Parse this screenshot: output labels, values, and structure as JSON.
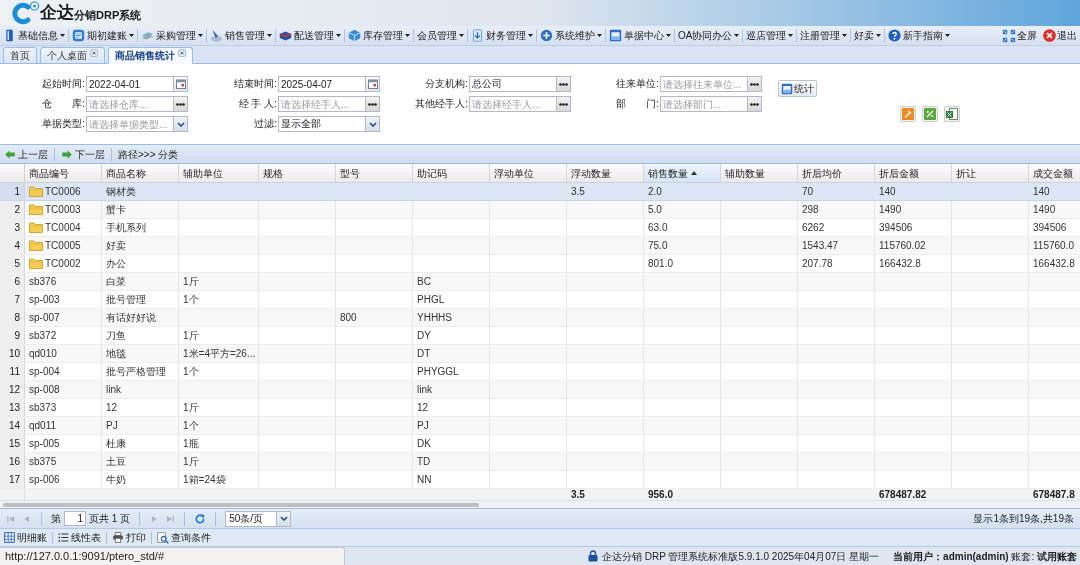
{
  "header": {
    "logo_main": "企达",
    "logo_sub": "分销DRP系统"
  },
  "menu": {
    "items": [
      {
        "label": "基础信息",
        "icon": true
      },
      {
        "label": "期初建账",
        "icon": true
      },
      {
        "label": "采购管理",
        "icon": true
      },
      {
        "label": "销售管理",
        "icon": true
      },
      {
        "label": "配送管理",
        "icon": true
      },
      {
        "label": "库存管理",
        "icon": true
      },
      {
        "label": "会员管理",
        "icon": false
      },
      {
        "label": "财务管理",
        "icon": true
      },
      {
        "label": "系统维护",
        "icon": true
      },
      {
        "label": "单据中心",
        "icon": true
      },
      {
        "label": "OA协同办公",
        "icon": false
      },
      {
        "label": "巡店管理",
        "icon": false
      },
      {
        "label": "注册管理",
        "icon": false
      },
      {
        "label": "好卖",
        "icon": false
      },
      {
        "label": "新手指南",
        "icon": true
      }
    ],
    "actions": [
      {
        "label": "全屏",
        "kind": "fullscreen"
      },
      {
        "label": "退出",
        "kind": "exit"
      }
    ]
  },
  "tabs": [
    {
      "label": "首页",
      "closable": false,
      "selected": false
    },
    {
      "label": "个人桌面",
      "closable": true,
      "selected": false
    },
    {
      "label": "商品销售统计",
      "closable": true,
      "selected": true
    }
  ],
  "filters": [
    {
      "label": "起始时间:",
      "kind": "date",
      "value": "2022-04-01"
    },
    {
      "label": "结束时间:",
      "kind": "date",
      "value": "2025-04-07"
    },
    {
      "label": "分支机构:",
      "kind": "picker",
      "value": "总公司"
    },
    {
      "label": "往来单位:",
      "kind": "picker",
      "placeholder": "请选择往来单位..."
    },
    {
      "label": "仓　　库:",
      "kind": "picker",
      "placeholder": "请选择仓库..."
    },
    {
      "label": "经 手 人:",
      "kind": "picker",
      "placeholder": "请选择经手人..."
    },
    {
      "label": "其他经手人:",
      "kind": "picker",
      "placeholder": "请选择经手人..."
    },
    {
      "label": "部　　门:",
      "kind": "picker",
      "placeholder": "请选择部门..."
    },
    {
      "label": "单据类型:",
      "kind": "select",
      "placeholder": "请选择单据类型..."
    },
    {
      "label": "过滤:",
      "kind": "select",
      "value": "显示全部"
    }
  ],
  "stat_button": "统计",
  "toolbar": {
    "back": "上一层",
    "forward": "下一层",
    "path": "路径>>> 分类"
  },
  "table": {
    "columns": [
      {
        "label": "商品编号",
        "sorted": false
      },
      {
        "label": "商品名称",
        "sorted": false
      },
      {
        "label": "辅助单位",
        "sorted": false
      },
      {
        "label": "规格",
        "sorted": false
      },
      {
        "label": "型号",
        "sorted": false
      },
      {
        "label": "助记码",
        "sorted": false
      },
      {
        "label": "浮动单位",
        "sorted": false
      },
      {
        "label": "浮动数量",
        "sorted": false,
        "total": "3.5"
      },
      {
        "label": "销售数量",
        "sorted": true,
        "total": "956.0"
      },
      {
        "label": "辅助数量",
        "sorted": false
      },
      {
        "label": "折后均价",
        "sorted": false
      },
      {
        "label": "折后金额",
        "sorted": false,
        "total": "678487.82"
      },
      {
        "label": "折让",
        "sorted": false
      },
      {
        "label": "成交金额",
        "sorted": false,
        "total": "678487.8"
      }
    ],
    "rows": [
      {
        "number": "1",
        "kind": "category",
        "selected": true,
        "cells": [
          "TC0006",
          "钢材类",
          null,
          null,
          null,
          null,
          null,
          "3.5",
          "2.0",
          null,
          "70",
          "140",
          null,
          "140"
        ]
      },
      {
        "number": "2",
        "kind": "category",
        "selected": false,
        "cells": [
          "TC0003",
          "蟹卡",
          null,
          null,
          null,
          null,
          null,
          null,
          "5.0",
          null,
          "298",
          "1490",
          null,
          "1490"
        ]
      },
      {
        "number": "3",
        "kind": "category",
        "selected": false,
        "cells": [
          "TC0004",
          "手机系列",
          null,
          null,
          null,
          null,
          null,
          null,
          "63.0",
          null,
          "6262",
          "394506",
          null,
          "394506"
        ]
      },
      {
        "number": "4",
        "kind": "category",
        "selected": false,
        "cells": [
          "TC0005",
          "好卖",
          null,
          null,
          null,
          null,
          null,
          null,
          "75.0",
          null,
          "1543.47",
          "115760.02",
          null,
          "115760.0"
        ]
      },
      {
        "number": "5",
        "kind": "category",
        "selected": false,
        "cells": [
          "TC0002",
          "办公",
          null,
          null,
          null,
          null,
          null,
          null,
          "801.0",
          null,
          "207.78",
          "166432.8",
          null,
          "166432.8"
        ]
      },
      {
        "number": "6",
        "kind": "product",
        "selected": false,
        "cells": [
          "sb376",
          "白菜",
          "1斤",
          null,
          null,
          "BC",
          null,
          null,
          null,
          null,
          null,
          null,
          null,
          null
        ]
      },
      {
        "number": "7",
        "kind": "product",
        "selected": false,
        "cells": [
          "sp-003",
          "批号管理",
          "1个",
          null,
          null,
          "PHGL",
          null,
          null,
          null,
          null,
          null,
          null,
          null,
          null
        ]
      },
      {
        "number": "8",
        "kind": "product",
        "selected": false,
        "cells": [
          "sp-007",
          "有话好好说",
          null,
          null,
          "800",
          "YHHHS",
          null,
          null,
          null,
          null,
          null,
          null,
          null,
          null
        ]
      },
      {
        "number": "9",
        "kind": "product",
        "selected": false,
        "cells": [
          "sb372",
          "刀鱼",
          "1斤",
          null,
          null,
          "DY",
          null,
          null,
          null,
          null,
          null,
          null,
          null,
          null
        ]
      },
      {
        "number": "10",
        "kind": "product",
        "selected": false,
        "cells": [
          "qd010",
          "地毯",
          "1米=4平方=26...",
          null,
          null,
          "DT",
          null,
          null,
          null,
          null,
          null,
          null,
          null,
          null
        ]
      },
      {
        "number": "11",
        "kind": "product",
        "selected": false,
        "cells": [
          "sp-004",
          "批号严格管理",
          "1个",
          null,
          null,
          "PHYGGL",
          null,
          null,
          null,
          null,
          null,
          null,
          null,
          null
        ]
      },
      {
        "number": "12",
        "kind": "product",
        "selected": false,
        "cells": [
          "sp-008",
          "link",
          null,
          null,
          null,
          "link",
          null,
          null,
          null,
          null,
          null,
          null,
          null,
          null
        ]
      },
      {
        "number": "13",
        "kind": "product",
        "selected": false,
        "cells": [
          "sb373",
          "12",
          "1斤",
          null,
          null,
          "12",
          null,
          null,
          null,
          null,
          null,
          null,
          null,
          null
        ]
      },
      {
        "number": "14",
        "kind": "product",
        "selected": false,
        "cells": [
          "qd011",
          "PJ",
          "1个",
          null,
          null,
          "PJ",
          null,
          null,
          null,
          null,
          null,
          null,
          null,
          null
        ]
      },
      {
        "number": "15",
        "kind": "product",
        "selected": false,
        "cells": [
          "sp-005",
          "杜康",
          "1瓶",
          null,
          null,
          "DK",
          null,
          null,
          null,
          null,
          null,
          null,
          null,
          null
        ]
      },
      {
        "number": "16",
        "kind": "product",
        "selected": false,
        "cells": [
          "sb375",
          "土豆",
          "1斤",
          null,
          null,
          "TD",
          null,
          null,
          null,
          null,
          null,
          null,
          null,
          null
        ]
      },
      {
        "number": "17",
        "kind": "product",
        "selected": false,
        "cells": [
          "sp-006",
          "牛奶",
          "1箱=24袋",
          null,
          null,
          "NN",
          null,
          null,
          null,
          null,
          null,
          null,
          null,
          null
        ]
      }
    ]
  },
  "pager": {
    "nav": [
      {
        "kind": "first",
        "disabled": true
      },
      {
        "kind": "prev",
        "disabled": true
      },
      {
        "kind": "next",
        "disabled": true
      },
      {
        "kind": "last",
        "disabled": true
      }
    ],
    "page_prefix": "第",
    "page": "1",
    "page_suffix": "页共 1 页",
    "page_size": "50条/页",
    "summary": "显示1条到19条,共19条"
  },
  "bottom_toolbar": [
    {
      "label": "明细账"
    },
    {
      "label": "线性表"
    },
    {
      "label": "打印"
    },
    {
      "label": "查询条件"
    }
  ],
  "status_bar": {
    "url": "http://127.0.0.1:9091/ptero_std/#",
    "info": "企达分销 DRP 管理系统标准版5.9.1.0 2025年04月07日 星期一",
    "user": "**当前用户：admin(admin)** 账套: **试用账套**"
  }
}
